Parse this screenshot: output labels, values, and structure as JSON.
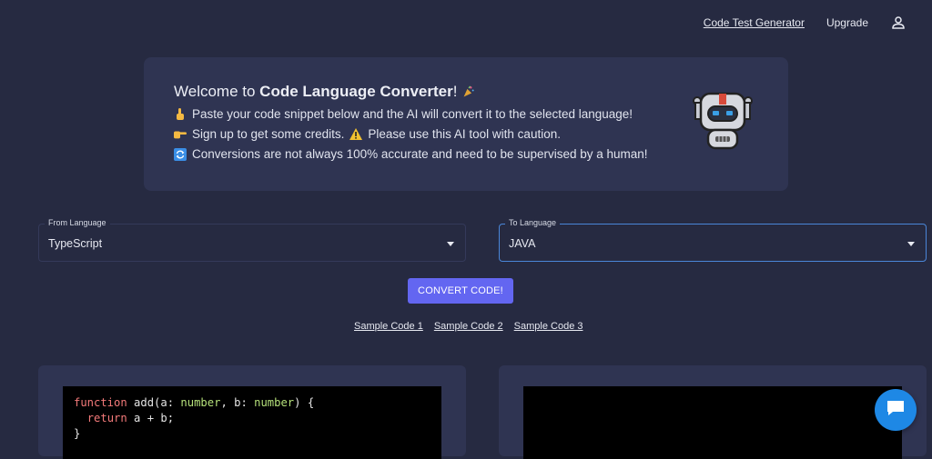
{
  "nav": {
    "test_generator": "Code Test Generator",
    "upgrade": "Upgrade"
  },
  "welcome": {
    "title_prefix": "Welcome to ",
    "title_bold": "Code Language Converter",
    "title_suffix": "!",
    "line1": "Paste your code snippet below and the AI will convert it to the selected language!",
    "line2a": "Sign up to get some credits.",
    "line2b": "Please use this AI tool with caution.",
    "line3": "Conversions are not always 100% accurate and need to be supervised by a human!"
  },
  "from_select": {
    "label": "From Language",
    "value": "TypeScript"
  },
  "to_select": {
    "label": "To Language",
    "value": "JAVA"
  },
  "convert_label": "CONVERT CODE!",
  "samples": [
    "Sample Code 1",
    "Sample Code 2",
    "Sample Code 3"
  ],
  "code": {
    "kw_function": "function",
    "fn_sig": " add(a: ",
    "type1": "number",
    "sep": ", b: ",
    "type2": "number",
    "brace_open": ") {",
    "indent": "  ",
    "kw_return": "return",
    "ret_expr": " a + b;",
    "brace_close": "}"
  },
  "colors": {
    "background": "#262a41",
    "card": "#2f3452",
    "accent": "#6366f1",
    "focus_border": "#4a86d8",
    "chat": "#1e88e5"
  },
  "icons": {
    "user": "user-icon",
    "party": "party-popper-icon",
    "point_down": "pointing-down-icon",
    "point_right": "pointing-right-icon",
    "warning": "warning-icon",
    "repeat": "repeat-icon",
    "robot": "robot-icon",
    "chat": "chat-icon",
    "caret": "caret-down-icon"
  }
}
